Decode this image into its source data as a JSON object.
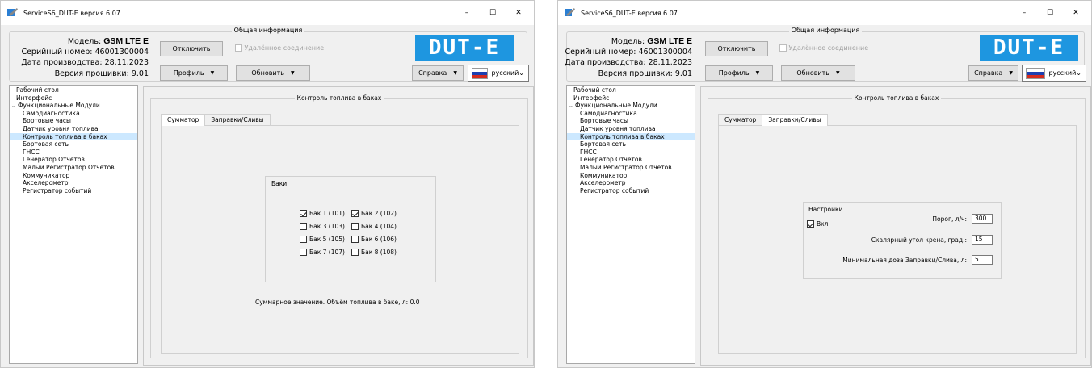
{
  "window": {
    "title": "ServiceS6_DUT-E версия 6.07",
    "minimize_glyph": "–",
    "maximize_glyph": "☐",
    "close_glyph": "✕"
  },
  "info": {
    "group_title": "Общая информация",
    "model_label": "Модель:",
    "model_value": "GSM LTE E",
    "serial_label": "Серийный номер:",
    "serial_value": "46001300004",
    "date_label": "Дата производства:",
    "date_value": "28.11.2023",
    "firmware_label": "Версия прошивки:",
    "firmware_value": "9.01",
    "disconnect_button": "Отключить",
    "remote_connection": "Удалённое соединение",
    "profile_button": "Профиль",
    "refresh_button": "Обновить",
    "help_button": "Справка",
    "language": "русский",
    "logo_text": "DUT-E"
  },
  "tree": [
    {
      "label": "Рабочий стол",
      "level": 1
    },
    {
      "label": "Интерфейс",
      "level": 1
    },
    {
      "label": "Функциональные Модули",
      "level": 1,
      "expanded": true
    },
    {
      "label": "Самодиагностика",
      "level": 2
    },
    {
      "label": "Бортовые часы",
      "level": 2
    },
    {
      "label": "Датчик уровня топлива",
      "level": 2
    },
    {
      "label": "Контроль топлива в баках",
      "level": 2,
      "selected": true
    },
    {
      "label": "Бортовая сеть",
      "level": 2
    },
    {
      "label": "ГНСС",
      "level": 2
    },
    {
      "label": "Генератор Отчетов",
      "level": 2
    },
    {
      "label": "Малый Регистратор Отчетов",
      "level": 2
    },
    {
      "label": "Коммуникатор",
      "level": 2
    },
    {
      "label": "Акселерометр",
      "level": 2
    },
    {
      "label": "Регистратор событий",
      "level": 2
    }
  ],
  "fuel_control": {
    "group_title": "Контроль топлива в баках",
    "tab_summator": "Сумматор",
    "tab_refuel": "Заправки/Сливы",
    "tanks_title": "Баки",
    "tanks": [
      {
        "label": "Бак 1 (101)",
        "checked": true
      },
      {
        "label": "Бак 2 (102)",
        "checked": true
      },
      {
        "label": "Бак 3 (103)",
        "checked": false
      },
      {
        "label": "Бак 4 (104)",
        "checked": false
      },
      {
        "label": "Бак 5 (105)",
        "checked": false
      },
      {
        "label": "Бак 6 (106)",
        "checked": false
      },
      {
        "label": "Бак 7 (107)",
        "checked": false
      },
      {
        "label": "Бак 8 (108)",
        "checked": false
      }
    ],
    "sum_text": "Суммарное значение. Объём топлива в баке, л:  0.0",
    "settings_title": "Настройки",
    "enable_label": "Вкл",
    "enable_checked": true,
    "threshold_label": "Порог, л/ч:",
    "threshold_value": "300",
    "roll_label": "Скалярный угол крена, град.:",
    "roll_value": "15",
    "min_dose_label": "Минимальная доза Заправки/Слива, л:",
    "min_dose_value": "5"
  },
  "colors": {
    "logo_bg": "#1e96e0",
    "selection": "#cce8ff",
    "window_bg": "#f0f0f0"
  }
}
